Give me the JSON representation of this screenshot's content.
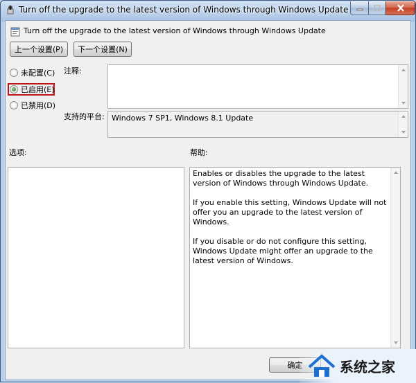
{
  "window": {
    "title": "Turn off the upgrade to the latest version of Windows through Windows Update"
  },
  "header": {
    "policy_title": "Turn off the upgrade to the latest version of Windows through Windows Update"
  },
  "nav": {
    "prev_label": "上一个设置(P)",
    "next_label": "下一个设置(N)"
  },
  "state": {
    "options": [
      {
        "label": "未配置(C)",
        "selected": false
      },
      {
        "label": "已启用(E)",
        "selected": true
      },
      {
        "label": "已禁用(D)",
        "selected": false
      }
    ]
  },
  "comment": {
    "label": "注释:",
    "value": ""
  },
  "platform": {
    "label": "支持的平台:",
    "value": "Windows 7 SP1, Windows 8.1 Update"
  },
  "options_panel": {
    "label": "选项:"
  },
  "help_panel": {
    "label": "帮助:",
    "paragraphs": [
      "Enables or disables the upgrade to the latest version of Windows through Windows Update.",
      "If you enable this setting, Windows Update will not offer you an upgrade to the latest version of Windows.",
      "If you disable or do not configure this setting, Windows Update might offer an upgrade to the latest version of Windows."
    ]
  },
  "footer": {
    "ok_label": "确定"
  },
  "watermark": {
    "text": "系统之家"
  },
  "colors": {
    "highlight_border": "#c0141c",
    "close_button": "#c23d22",
    "selected_radio": "#1b6a1b"
  },
  "icons": [
    "policy-icon",
    "minimize-icon",
    "maximize-icon",
    "close-icon",
    "settings-icon"
  ]
}
